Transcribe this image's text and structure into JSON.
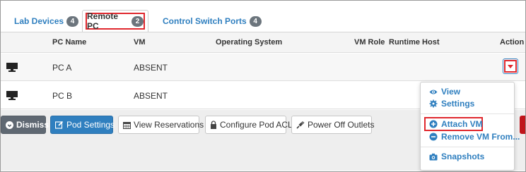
{
  "tabs": [
    {
      "label": "Lab Devices",
      "count": "4"
    },
    {
      "label": "Remote PC",
      "count": "2",
      "active": true
    },
    {
      "label": "Control Switch Ports",
      "count": "4"
    }
  ],
  "table": {
    "headers": [
      "PC Name",
      "VM",
      "Operating System",
      "VM Role",
      "Runtime Host",
      "Action"
    ],
    "rows": [
      {
        "pc_name": "PC A",
        "vm": "ABSENT",
        "os": "",
        "vm_role": "",
        "runtime_host": ""
      },
      {
        "pc_name": "PC B",
        "vm": "ABSENT",
        "os": "",
        "vm_role": "",
        "runtime_host": ""
      }
    ]
  },
  "toolbar": {
    "dismiss": "Dismiss",
    "pod_settings": "Pod Settings",
    "view_reservations": "View Reservations",
    "configure_acl": "Configure Pod ACL",
    "power_off": "Power Off Outlets"
  },
  "action_menu": {
    "items": [
      "View",
      "Settings",
      "Attach VM",
      "Remove VM From...",
      "Snapshots"
    ]
  },
  "colors": {
    "accent": "#2f7fbf",
    "highlight": "#e0282e",
    "badge": "#6c757d",
    "dismiss": "#5f6872"
  },
  "icons": {
    "row_device": "monitor-icon",
    "action": "caret-down-icon",
    "dismiss": "times-circle-icon",
    "pod_settings": "edit-icon",
    "reservations": "calendar-icon",
    "acl": "lock-icon",
    "power": "plug-icon",
    "view": "eye-icon",
    "settings": "cogs-icon",
    "attach": "plus-circle-icon",
    "remove": "minus-circle-icon",
    "snapshots": "camera-icon"
  }
}
